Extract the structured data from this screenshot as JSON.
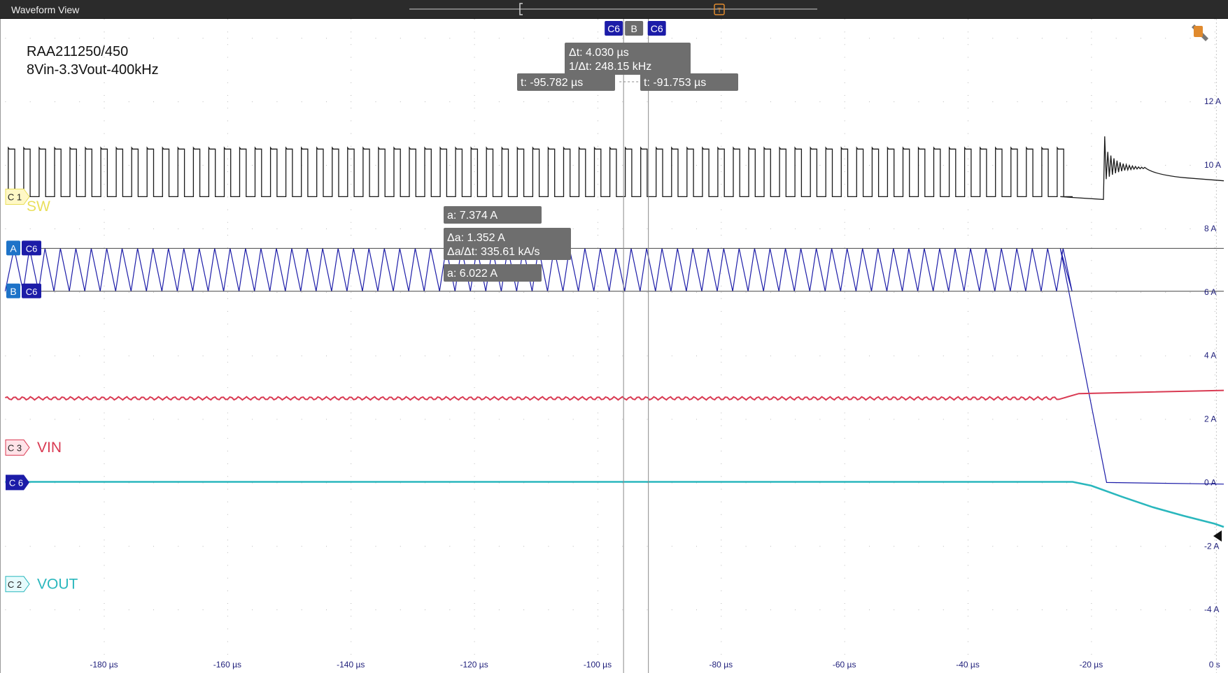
{
  "window": {
    "title": "Waveform View"
  },
  "annotation": {
    "line1": "RAA211250/450",
    "line2": "8Vin-3.3Vout-400kHz"
  },
  "channels": [
    {
      "id": "C 1",
      "name": "SW",
      "color": "#e9df5a",
      "badge_color": "#fff8c6"
    },
    {
      "id": "C 3",
      "name": "VIN",
      "color": "#d93a52",
      "badge_color": "#ffe3e8"
    },
    {
      "id": "C 2",
      "name": "VOUT",
      "color": "#2ab7bd",
      "badge_color": "#e6fbfc"
    },
    {
      "id": "C 6",
      "name": "",
      "color": "#1c1ca8",
      "badge_color": "#1c1ca8"
    }
  ],
  "time_cursors": {
    "labels": [
      "C6",
      "B",
      "C6"
    ],
    "delta_t": "Δt: 4.030 µs",
    "inv_delta_t": "1/Δt: 248.15 kHz",
    "t1": "t: -95.782 µs",
    "t2": "t: -91.753 µs",
    "t1_value_us": -95.782,
    "t2_value_us": -91.753
  },
  "amp_cursors": {
    "a_label": "A",
    "b_label": "B",
    "source": "C6",
    "a_value": "a: 7.374 A",
    "delta": "Δa: 1.352 A",
    "slope": "Δa/Δt: 335.61 kA/s",
    "b_value": "a: 6.022 A",
    "a_amps": 7.374,
    "b_amps": 6.022
  },
  "trigger_marker": "T",
  "x_axis": {
    "ticks": [
      "-180 µs",
      "-160 µs",
      "-140 µs",
      "-120 µs",
      "-100 µs",
      "-80 µs",
      "-60 µs",
      "-40 µs",
      "-20 µs",
      "0 s"
    ],
    "tick_values_us": [
      -180,
      -160,
      -140,
      -120,
      -100,
      -80,
      -60,
      -40,
      -20,
      0
    ],
    "range_us": [
      -196.5,
      1.5
    ]
  },
  "y_axis": {
    "ticks": [
      "12 A",
      "10 A",
      "8 A",
      "6 A",
      "4 A",
      "2 A",
      "0 A",
      "-2 A",
      "-4 A"
    ],
    "tick_values": [
      12,
      10,
      8,
      6,
      4,
      2,
      0,
      -2,
      -4
    ],
    "range_A": [
      -6,
      14.6
    ]
  },
  "traces": {
    "inductor_current_C6": {
      "x_us": [
        -196,
        -25,
        -17.5,
        1.5
      ],
      "y_A": [
        6.7,
        6.7,
        0.0,
        0.0
      ],
      "ripple_peak_A": 7.374,
      "ripple_valley_A": 6.022,
      "switching_khz": 400
    },
    "vout_C2": {
      "x_us": [
        -196,
        -23,
        -20,
        -15,
        -10,
        -5,
        0,
        1.5
      ],
      "y_A": [
        0.02,
        0.02,
        -0.1,
        -0.45,
        -0.78,
        -1.05,
        -1.3,
        -1.4
      ]
    },
    "vin_C3": {
      "x_us": [
        -196,
        -25,
        -22,
        1.5
      ],
      "y_A": [
        2.65,
        2.65,
        2.8,
        2.9
      ]
    },
    "sw_C1": {
      "x_us": [
        -196,
        -25,
        -18,
        -17.5,
        1.5
      ],
      "y_A": [
        9.9,
        9.9,
        9.0,
        10.9,
        9.5
      ],
      "high_A": 10.5,
      "low_A": 9.0
    }
  }
}
